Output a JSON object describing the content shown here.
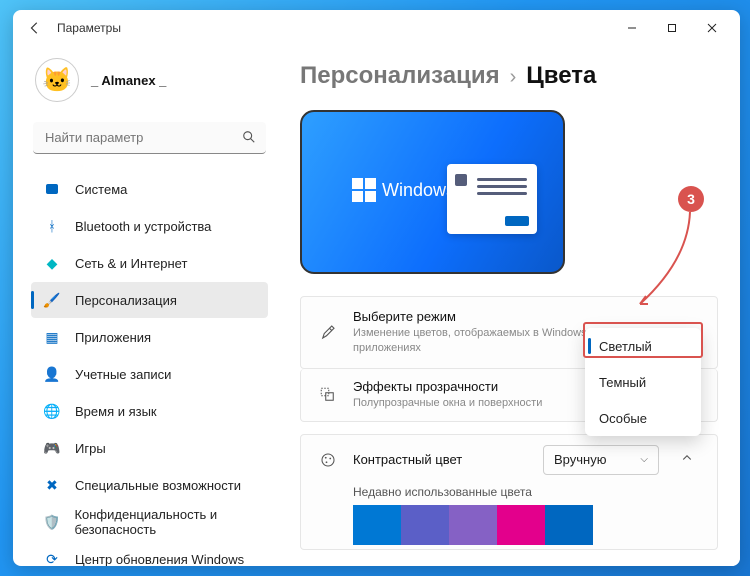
{
  "window": {
    "title": "Параметры"
  },
  "profile": {
    "username": "_ Almanex _"
  },
  "search": {
    "placeholder": "Найти параметр"
  },
  "sidebar": {
    "items": [
      {
        "label": "Система",
        "icon": "system"
      },
      {
        "label": "Bluetooth и устройства",
        "icon": "bluetooth"
      },
      {
        "label": "Сеть & и Интернет",
        "icon": "network"
      },
      {
        "label": "Персонализация",
        "icon": "personalization",
        "selected": true
      },
      {
        "label": "Приложения",
        "icon": "apps"
      },
      {
        "label": "Учетные записи",
        "icon": "accounts"
      },
      {
        "label": "Время и язык",
        "icon": "time"
      },
      {
        "label": "Игры",
        "icon": "gaming"
      },
      {
        "label": "Специальные возможности",
        "icon": "accessibility"
      },
      {
        "label": "Конфиденциальность и безопасность",
        "icon": "privacy"
      },
      {
        "label": "Центр обновления Windows",
        "icon": "update"
      }
    ]
  },
  "breadcrumb": {
    "parent": "Персонализация",
    "current": "Цвета"
  },
  "preview": {
    "brand_text": "Windows"
  },
  "settings": {
    "mode": {
      "title": "Выберите режим",
      "desc": "Изменение цветов, отображаемых в Windows и ваших приложениях",
      "value": "Светлый",
      "options": [
        "Светлый",
        "Темный",
        "Особые"
      ]
    },
    "transparency": {
      "title": "Эффекты прозрачности",
      "desc": "Полупрозрачные окна и поверхности"
    },
    "accent": {
      "title": "Контрастный цвет",
      "value": "Вручную",
      "recent_label": "Недавно использованные цвета",
      "swatches": [
        "#0078d4",
        "#5b5fc7",
        "#8561c5",
        "#e3008c",
        "#0067c0"
      ]
    }
  },
  "annotation": {
    "number": "3"
  }
}
